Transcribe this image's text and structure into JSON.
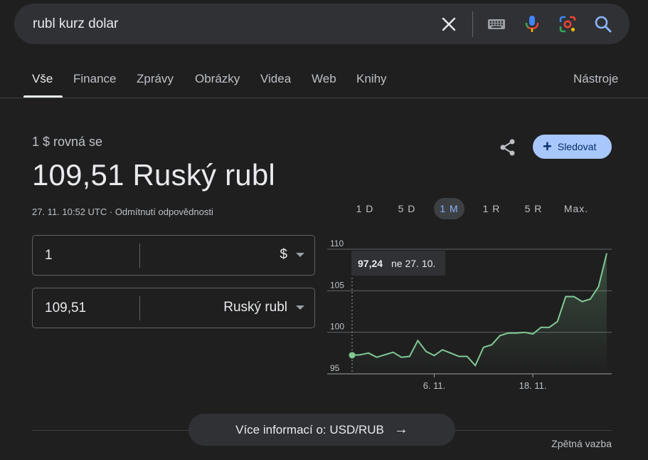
{
  "search": {
    "query": "rubl kurz dolar"
  },
  "tabs": [
    "Vše",
    "Finance",
    "Zprávy",
    "Obrázky",
    "Videa",
    "Web",
    "Knihy"
  ],
  "tools_label": "Nástroje",
  "converter": {
    "equals_label": "1 $ rovná se",
    "result_value": "109,51 Ruský rubl",
    "timestamp": "27. 11. 10:52 UTC · Odmítnutí odpovědnosti",
    "from_amount": "1",
    "from_currency": "$",
    "to_amount": "109,51",
    "to_currency": "Ruský rubl"
  },
  "follow_label": "Sledovat",
  "ranges": [
    "1 D",
    "5 D",
    "1 M",
    "1 R",
    "5 R",
    "Max."
  ],
  "active_range": "1 M",
  "tooltip": {
    "value": "97,24",
    "date": "ne 27. 10."
  },
  "more_info_label": "Více informací o: USD/RUB",
  "feedback_label": "Zpětná vazba",
  "colors": {
    "accent": "#a8c7fa",
    "line": "#81c995",
    "background": "#1f1f1f"
  },
  "chart_data": {
    "type": "area",
    "ylim": [
      95,
      110
    ],
    "yticks": [
      95,
      100,
      105,
      110
    ],
    "xtick_labels": [
      {
        "label": "6. 11.",
        "index": 10
      },
      {
        "label": "18. 11.",
        "index": 22
      }
    ],
    "values": [
      97.24,
      97.3,
      97.5,
      97.0,
      97.3,
      97.6,
      97.0,
      97.1,
      99.0,
      97.7,
      97.2,
      97.9,
      97.5,
      97.1,
      97.1,
      96.0,
      98.2,
      98.5,
      99.6,
      99.9,
      99.9,
      100.0,
      99.8,
      100.6,
      100.6,
      101.3,
      104.3,
      104.3,
      103.7,
      104.0,
      105.5,
      109.5
    ],
    "highlight_index": 0
  }
}
